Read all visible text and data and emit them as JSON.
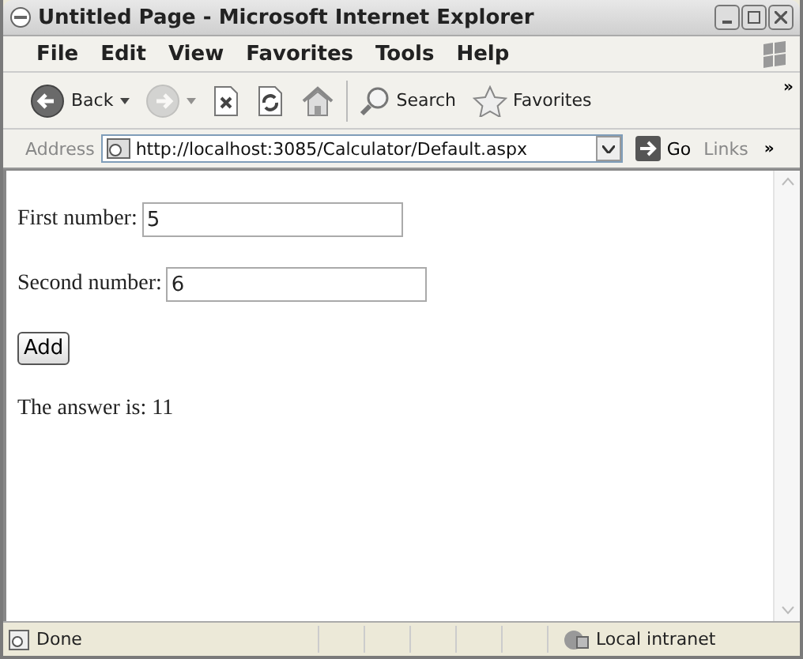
{
  "window": {
    "title": "Untitled Page - Microsoft Internet Explorer"
  },
  "menu": [
    "File",
    "Edit",
    "View",
    "Favorites",
    "Tools",
    "Help"
  ],
  "toolbar": [
    {
      "kind": "back",
      "label": "Back",
      "disabled": false
    },
    {
      "kind": "forward",
      "disabled": true
    },
    {
      "kind": "stop",
      "disabled": false
    },
    {
      "kind": "refresh",
      "disabled": false
    },
    {
      "kind": "home",
      "disabled": false
    },
    {
      "kind": "search",
      "label": "Search",
      "disabled": false
    },
    {
      "kind": "favorites",
      "label": "Favorites",
      "disabled": false
    }
  ],
  "toolbar_more": "»",
  "address_bar": {
    "label": "Address",
    "url": "http://localhost:3085/Calculator/Default.aspx",
    "go": "Go",
    "links": "Links",
    "more": "»"
  },
  "page": {
    "fields": [
      {
        "label": "First number:",
        "value": "5"
      },
      {
        "label": "Second number:",
        "value": "6"
      }
    ],
    "button": "Add",
    "result": "The answer is: 11"
  },
  "status_bar": {
    "text": "Done",
    "zone": "Local intranet"
  }
}
